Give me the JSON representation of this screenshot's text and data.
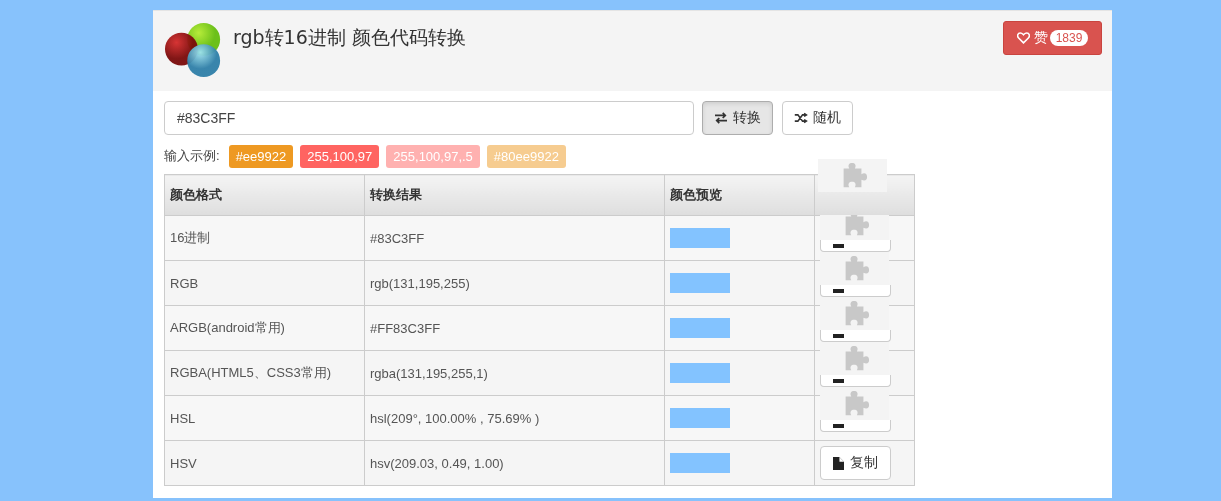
{
  "header": {
    "title": "rgb转16进制 颜色代码转换",
    "like_button": {
      "label": "赞",
      "count": "1839"
    }
  },
  "input": {
    "value": "#83C3FF"
  },
  "actions": [
    {
      "kind": "convert",
      "label": "转换",
      "selected": true
    },
    {
      "kind": "random",
      "label": "随机",
      "selected": false
    }
  ],
  "examples": {
    "label": "输入示例:",
    "items": [
      {
        "text": "#ee9922",
        "color": "#ee9922"
      },
      {
        "text": "255,100,97",
        "color": "#ff6461"
      },
      {
        "text": "255,100,97,.5",
        "color": "#ffb1b0"
      },
      {
        "text": "#80ee9922",
        "color": "#f6cc90"
      }
    ]
  },
  "table": {
    "columns": [
      "颜色格式",
      "转换结果",
      "颜色预览"
    ],
    "header_plugin_blocked": true,
    "rows": [
      {
        "format": "16进制",
        "result": "#83C3FF",
        "color": "#83c3ff",
        "plugin_blocked": true
      },
      {
        "format": "RGB",
        "result": "rgb(131,195,255)",
        "color": "#83c3ff",
        "plugin_blocked": true
      },
      {
        "format": "ARGB(android常用)",
        "result": "#FF83C3FF",
        "color": "#83c3ff",
        "plugin_blocked": true
      },
      {
        "format": "RGBA(HTML5、CSS3常用)",
        "result": "rgba(131,195,255,1)",
        "color": "#83c3ff",
        "plugin_blocked": true
      },
      {
        "format": "HSL",
        "result": "hsl(209°, 100.00% , 75.69% )",
        "color": "#83c3ff",
        "plugin_blocked": true
      },
      {
        "format": "HSV",
        "result": "hsv(209.03, 0.49, 1.00)",
        "color": "#83c3ff",
        "copy_label": "复制",
        "plugin_blocked": false
      }
    ]
  }
}
